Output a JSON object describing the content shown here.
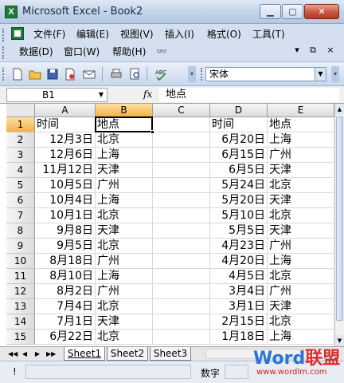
{
  "window": {
    "title": "Microsoft Excel - Book2",
    "app_icon_glyph": "X",
    "doc_icon": "workbook-icon"
  },
  "menu": {
    "row1": [
      "文件(F)",
      "编辑(E)",
      "视图(V)",
      "插入(I)",
      "格式(O)",
      "工具(T)"
    ],
    "row2": [
      "数据(D)",
      "窗口(W)",
      "帮助(H)"
    ],
    "controls": [
      "▾",
      "⧉",
      "×"
    ]
  },
  "toolbar": {
    "icons": [
      "new-file-icon",
      "open-folder-icon",
      "save-icon",
      "permission-icon",
      "email-icon",
      "print-icon",
      "print-preview-icon",
      "spelling-icon"
    ],
    "font_name": "宋体"
  },
  "formula_bar": {
    "name_box": "B1",
    "fx": "fx",
    "content": "地点"
  },
  "grid": {
    "columns": [
      "A",
      "B",
      "C",
      "D",
      "E"
    ],
    "active_column": "B",
    "active_row": 1,
    "rows": [
      {
        "num": "1",
        "A": "时间",
        "B": "地点",
        "C": "",
        "D": "时间",
        "E": "地点"
      },
      {
        "num": "2",
        "A": "12月3日",
        "B": "北京",
        "C": "",
        "D": "6月20日",
        "E": "上海"
      },
      {
        "num": "3",
        "A": "12月6日",
        "B": "上海",
        "C": "",
        "D": "6月15日",
        "E": "广州"
      },
      {
        "num": "4",
        "A": "11月12日",
        "B": "天津",
        "C": "",
        "D": "6月5日",
        "E": "天津"
      },
      {
        "num": "5",
        "A": "10月5日",
        "B": "广州",
        "C": "",
        "D": "5月24日",
        "E": "北京"
      },
      {
        "num": "6",
        "A": "10月4日",
        "B": "上海",
        "C": "",
        "D": "5月20日",
        "E": "天津"
      },
      {
        "num": "7",
        "A": "10月1日",
        "B": "北京",
        "C": "",
        "D": "5月10日",
        "E": "北京"
      },
      {
        "num": "8",
        "A": "9月8日",
        "B": "天津",
        "C": "",
        "D": "5月5日",
        "E": "天津"
      },
      {
        "num": "9",
        "A": "9月5日",
        "B": "北京",
        "C": "",
        "D": "4月23日",
        "E": "广州"
      },
      {
        "num": "10",
        "A": "8月18日",
        "B": "广州",
        "C": "",
        "D": "4月20日",
        "E": "上海"
      },
      {
        "num": "11",
        "A": "8月10日",
        "B": "上海",
        "C": "",
        "D": "4月5日",
        "E": "北京"
      },
      {
        "num": "12",
        "A": "8月2日",
        "B": "广州",
        "C": "",
        "D": "3月4日",
        "E": "广州"
      },
      {
        "num": "13",
        "A": "7月4日",
        "B": "北京",
        "C": "",
        "D": "3月1日",
        "E": "天津"
      },
      {
        "num": "14",
        "A": "7月1日",
        "B": "天津",
        "C": "",
        "D": "2月15日",
        "E": "北京"
      },
      {
        "num": "15",
        "A": "6月22日",
        "B": "北京",
        "C": "",
        "D": "1月18日",
        "E": "上海"
      }
    ]
  },
  "sheets": {
    "tabs": [
      "Sheet1",
      "Sheet2",
      "Sheet3"
    ],
    "active": "Sheet1",
    "nav": [
      "◀◀",
      "◀",
      "▶",
      "▶▶"
    ]
  },
  "status": {
    "left": "!",
    "mode": "数字"
  },
  "watermark": {
    "word": "Word",
    "cn": "联盟",
    "url": "www.wordlm.com"
  }
}
